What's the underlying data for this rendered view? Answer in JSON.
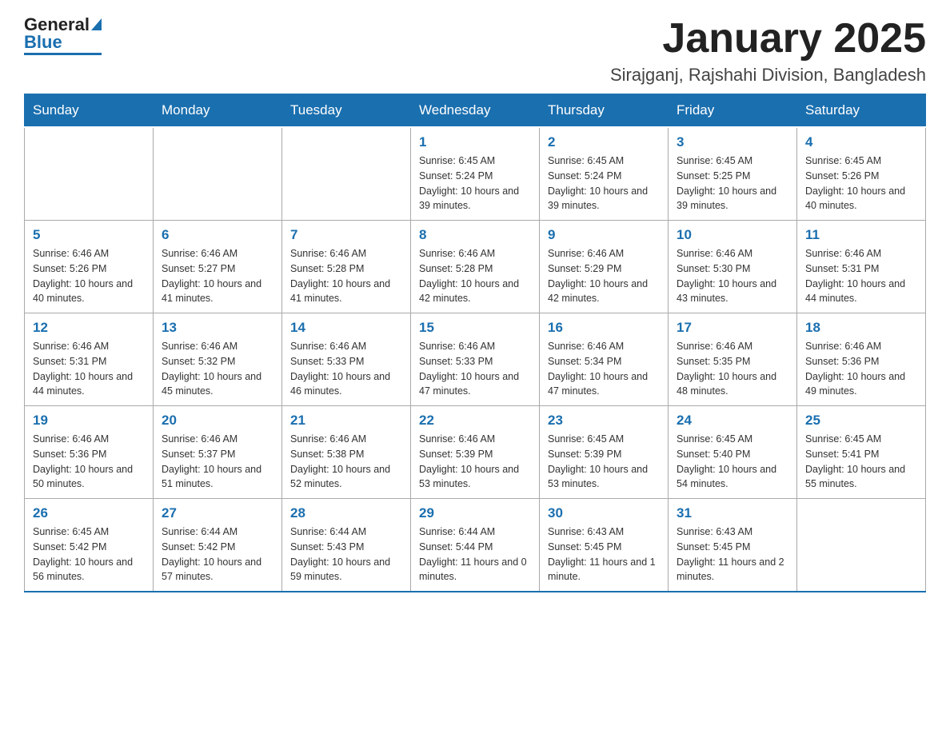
{
  "header": {
    "logo": {
      "general": "General",
      "blue": "Blue"
    },
    "title": "January 2025",
    "location": "Sirajganj, Rajshahi Division, Bangladesh"
  },
  "weekdays": [
    "Sunday",
    "Monday",
    "Tuesday",
    "Wednesday",
    "Thursday",
    "Friday",
    "Saturday"
  ],
  "weeks": [
    [
      {
        "day": "",
        "sunrise": "",
        "sunset": "",
        "daylight": ""
      },
      {
        "day": "",
        "sunrise": "",
        "sunset": "",
        "daylight": ""
      },
      {
        "day": "",
        "sunrise": "",
        "sunset": "",
        "daylight": ""
      },
      {
        "day": "1",
        "sunrise": "Sunrise: 6:45 AM",
        "sunset": "Sunset: 5:24 PM",
        "daylight": "Daylight: 10 hours and 39 minutes."
      },
      {
        "day": "2",
        "sunrise": "Sunrise: 6:45 AM",
        "sunset": "Sunset: 5:24 PM",
        "daylight": "Daylight: 10 hours and 39 minutes."
      },
      {
        "day": "3",
        "sunrise": "Sunrise: 6:45 AM",
        "sunset": "Sunset: 5:25 PM",
        "daylight": "Daylight: 10 hours and 39 minutes."
      },
      {
        "day": "4",
        "sunrise": "Sunrise: 6:45 AM",
        "sunset": "Sunset: 5:26 PM",
        "daylight": "Daylight: 10 hours and 40 minutes."
      }
    ],
    [
      {
        "day": "5",
        "sunrise": "Sunrise: 6:46 AM",
        "sunset": "Sunset: 5:26 PM",
        "daylight": "Daylight: 10 hours and 40 minutes."
      },
      {
        "day": "6",
        "sunrise": "Sunrise: 6:46 AM",
        "sunset": "Sunset: 5:27 PM",
        "daylight": "Daylight: 10 hours and 41 minutes."
      },
      {
        "day": "7",
        "sunrise": "Sunrise: 6:46 AM",
        "sunset": "Sunset: 5:28 PM",
        "daylight": "Daylight: 10 hours and 41 minutes."
      },
      {
        "day": "8",
        "sunrise": "Sunrise: 6:46 AM",
        "sunset": "Sunset: 5:28 PM",
        "daylight": "Daylight: 10 hours and 42 minutes."
      },
      {
        "day": "9",
        "sunrise": "Sunrise: 6:46 AM",
        "sunset": "Sunset: 5:29 PM",
        "daylight": "Daylight: 10 hours and 42 minutes."
      },
      {
        "day": "10",
        "sunrise": "Sunrise: 6:46 AM",
        "sunset": "Sunset: 5:30 PM",
        "daylight": "Daylight: 10 hours and 43 minutes."
      },
      {
        "day": "11",
        "sunrise": "Sunrise: 6:46 AM",
        "sunset": "Sunset: 5:31 PM",
        "daylight": "Daylight: 10 hours and 44 minutes."
      }
    ],
    [
      {
        "day": "12",
        "sunrise": "Sunrise: 6:46 AM",
        "sunset": "Sunset: 5:31 PM",
        "daylight": "Daylight: 10 hours and 44 minutes."
      },
      {
        "day": "13",
        "sunrise": "Sunrise: 6:46 AM",
        "sunset": "Sunset: 5:32 PM",
        "daylight": "Daylight: 10 hours and 45 minutes."
      },
      {
        "day": "14",
        "sunrise": "Sunrise: 6:46 AM",
        "sunset": "Sunset: 5:33 PM",
        "daylight": "Daylight: 10 hours and 46 minutes."
      },
      {
        "day": "15",
        "sunrise": "Sunrise: 6:46 AM",
        "sunset": "Sunset: 5:33 PM",
        "daylight": "Daylight: 10 hours and 47 minutes."
      },
      {
        "day": "16",
        "sunrise": "Sunrise: 6:46 AM",
        "sunset": "Sunset: 5:34 PM",
        "daylight": "Daylight: 10 hours and 47 minutes."
      },
      {
        "day": "17",
        "sunrise": "Sunrise: 6:46 AM",
        "sunset": "Sunset: 5:35 PM",
        "daylight": "Daylight: 10 hours and 48 minutes."
      },
      {
        "day": "18",
        "sunrise": "Sunrise: 6:46 AM",
        "sunset": "Sunset: 5:36 PM",
        "daylight": "Daylight: 10 hours and 49 minutes."
      }
    ],
    [
      {
        "day": "19",
        "sunrise": "Sunrise: 6:46 AM",
        "sunset": "Sunset: 5:36 PM",
        "daylight": "Daylight: 10 hours and 50 minutes."
      },
      {
        "day": "20",
        "sunrise": "Sunrise: 6:46 AM",
        "sunset": "Sunset: 5:37 PM",
        "daylight": "Daylight: 10 hours and 51 minutes."
      },
      {
        "day": "21",
        "sunrise": "Sunrise: 6:46 AM",
        "sunset": "Sunset: 5:38 PM",
        "daylight": "Daylight: 10 hours and 52 minutes."
      },
      {
        "day": "22",
        "sunrise": "Sunrise: 6:46 AM",
        "sunset": "Sunset: 5:39 PM",
        "daylight": "Daylight: 10 hours and 53 minutes."
      },
      {
        "day": "23",
        "sunrise": "Sunrise: 6:45 AM",
        "sunset": "Sunset: 5:39 PM",
        "daylight": "Daylight: 10 hours and 53 minutes."
      },
      {
        "day": "24",
        "sunrise": "Sunrise: 6:45 AM",
        "sunset": "Sunset: 5:40 PM",
        "daylight": "Daylight: 10 hours and 54 minutes."
      },
      {
        "day": "25",
        "sunrise": "Sunrise: 6:45 AM",
        "sunset": "Sunset: 5:41 PM",
        "daylight": "Daylight: 10 hours and 55 minutes."
      }
    ],
    [
      {
        "day": "26",
        "sunrise": "Sunrise: 6:45 AM",
        "sunset": "Sunset: 5:42 PM",
        "daylight": "Daylight: 10 hours and 56 minutes."
      },
      {
        "day": "27",
        "sunrise": "Sunrise: 6:44 AM",
        "sunset": "Sunset: 5:42 PM",
        "daylight": "Daylight: 10 hours and 57 minutes."
      },
      {
        "day": "28",
        "sunrise": "Sunrise: 6:44 AM",
        "sunset": "Sunset: 5:43 PM",
        "daylight": "Daylight: 10 hours and 59 minutes."
      },
      {
        "day": "29",
        "sunrise": "Sunrise: 6:44 AM",
        "sunset": "Sunset: 5:44 PM",
        "daylight": "Daylight: 11 hours and 0 minutes."
      },
      {
        "day": "30",
        "sunrise": "Sunrise: 6:43 AM",
        "sunset": "Sunset: 5:45 PM",
        "daylight": "Daylight: 11 hours and 1 minute."
      },
      {
        "day": "31",
        "sunrise": "Sunrise: 6:43 AM",
        "sunset": "Sunset: 5:45 PM",
        "daylight": "Daylight: 11 hours and 2 minutes."
      },
      {
        "day": "",
        "sunrise": "",
        "sunset": "",
        "daylight": ""
      }
    ]
  ]
}
